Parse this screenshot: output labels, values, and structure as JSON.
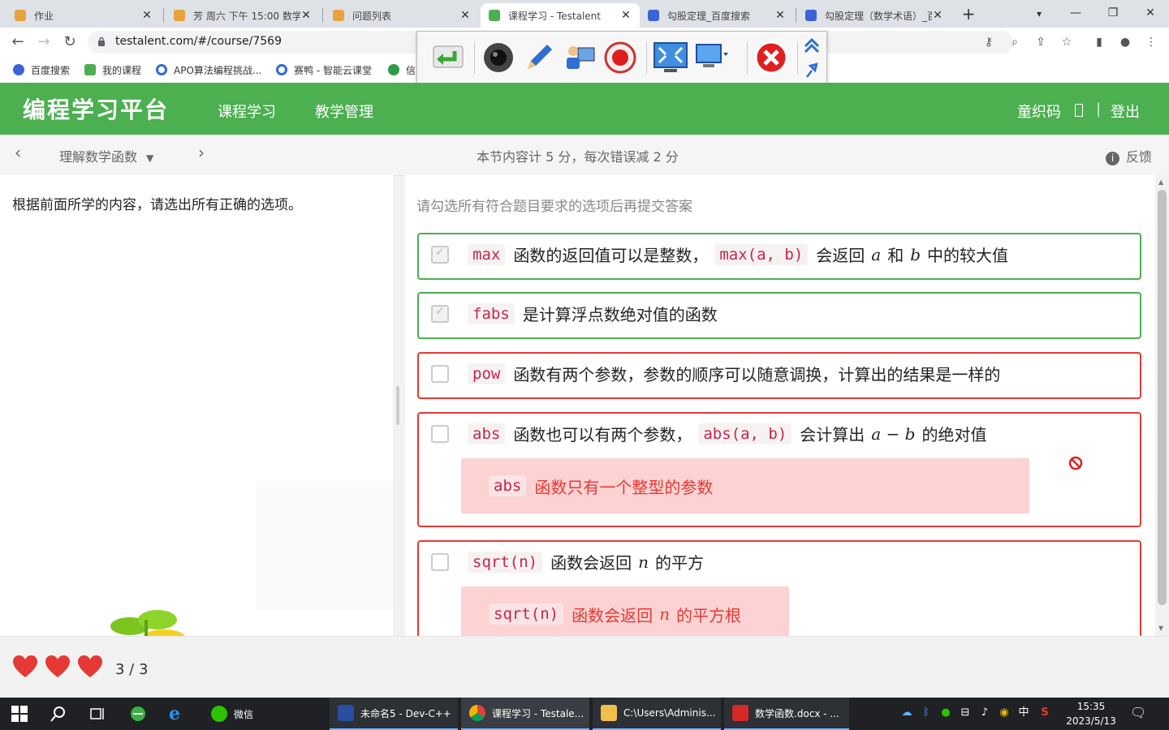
{
  "browser": {
    "tabs": [
      {
        "title": "作业",
        "active": false
      },
      {
        "title": "芳 周六 下午 15:00 数学",
        "active": false
      },
      {
        "title": "问题列表",
        "active": false
      },
      {
        "title": "课程学习 - Testalent",
        "active": true
      },
      {
        "title": "勾股定理_百度搜索",
        "active": false
      },
      {
        "title": "勾股定理（数学术语）_百",
        "active": false
      }
    ],
    "url": "testalent.com/#/course/7569",
    "bookmarks": [
      "百度搜索",
      "我的课程",
      "APO算法编程挑战...",
      "赛鸭 - 智能云课堂",
      "信"
    ]
  },
  "app": {
    "logo": "编程学习平台",
    "nav": [
      "课程学习",
      "教学管理"
    ],
    "user": "童织码",
    "logout": "登出",
    "user_sep": "|"
  },
  "subnav": {
    "lesson": "理解数学函数",
    "score_info": "本节内容计 5 分，每次错误减 2 分",
    "feedback": "反馈"
  },
  "question": {
    "prompt": "根据前面所学的内容，请选出所有正确的选项。",
    "instruction": "请勾选所有符合题目要求的选项后再提交答案"
  },
  "options": {
    "o1": {
      "code1": "max",
      "t1": "函数的返回值可以是整数，",
      "code2": "max(a, b)",
      "t2": "会返回",
      "m1": "a",
      "t3": "和",
      "m2": "b",
      "t4": "中的较大值",
      "status": "correct"
    },
    "o2": {
      "code1": "fabs",
      "t1": "是计算浮点数绝对值的函数",
      "status": "correct"
    },
    "o3": {
      "code1": "pow",
      "t1": "函数有两个参数，参数的顺序可以随意调换，计算出的结果是一样的",
      "status": "wrong"
    },
    "o4": {
      "code1": "abs",
      "t1": "函数也可以有两个参数，",
      "code2": "abs(a, b)",
      "t2": "会计算出",
      "m1": "a − b",
      "t3": "的绝对值",
      "fb_code": "abs",
      "fb_text": "函数只有一个整型的参数",
      "status": "wrong"
    },
    "o5": {
      "code1": "sqrt(n)",
      "t1": "函数会返回",
      "m1": "n",
      "t2": "的平方",
      "fb_code": "sqrt(n)",
      "fb_t1": "函数会返回",
      "fb_m1": "n",
      "fb_t2": "的平方根",
      "status": "wrong"
    }
  },
  "footer": {
    "hearts": 3,
    "lives_text": "3 / 3"
  },
  "taskbar": {
    "windows": [
      "微信",
      "未命名5 - Dev-C++",
      "课程学习 - Testale...",
      "C:\\Users\\Adminis...",
      "数学函数.docx - ..."
    ],
    "ime": "中",
    "time": "15:35",
    "date": "2023/5/13"
  },
  "colors": {
    "brand_green": "#4caf50",
    "error_red": "#e53935",
    "feedback_bg": "#fcd2d2"
  }
}
